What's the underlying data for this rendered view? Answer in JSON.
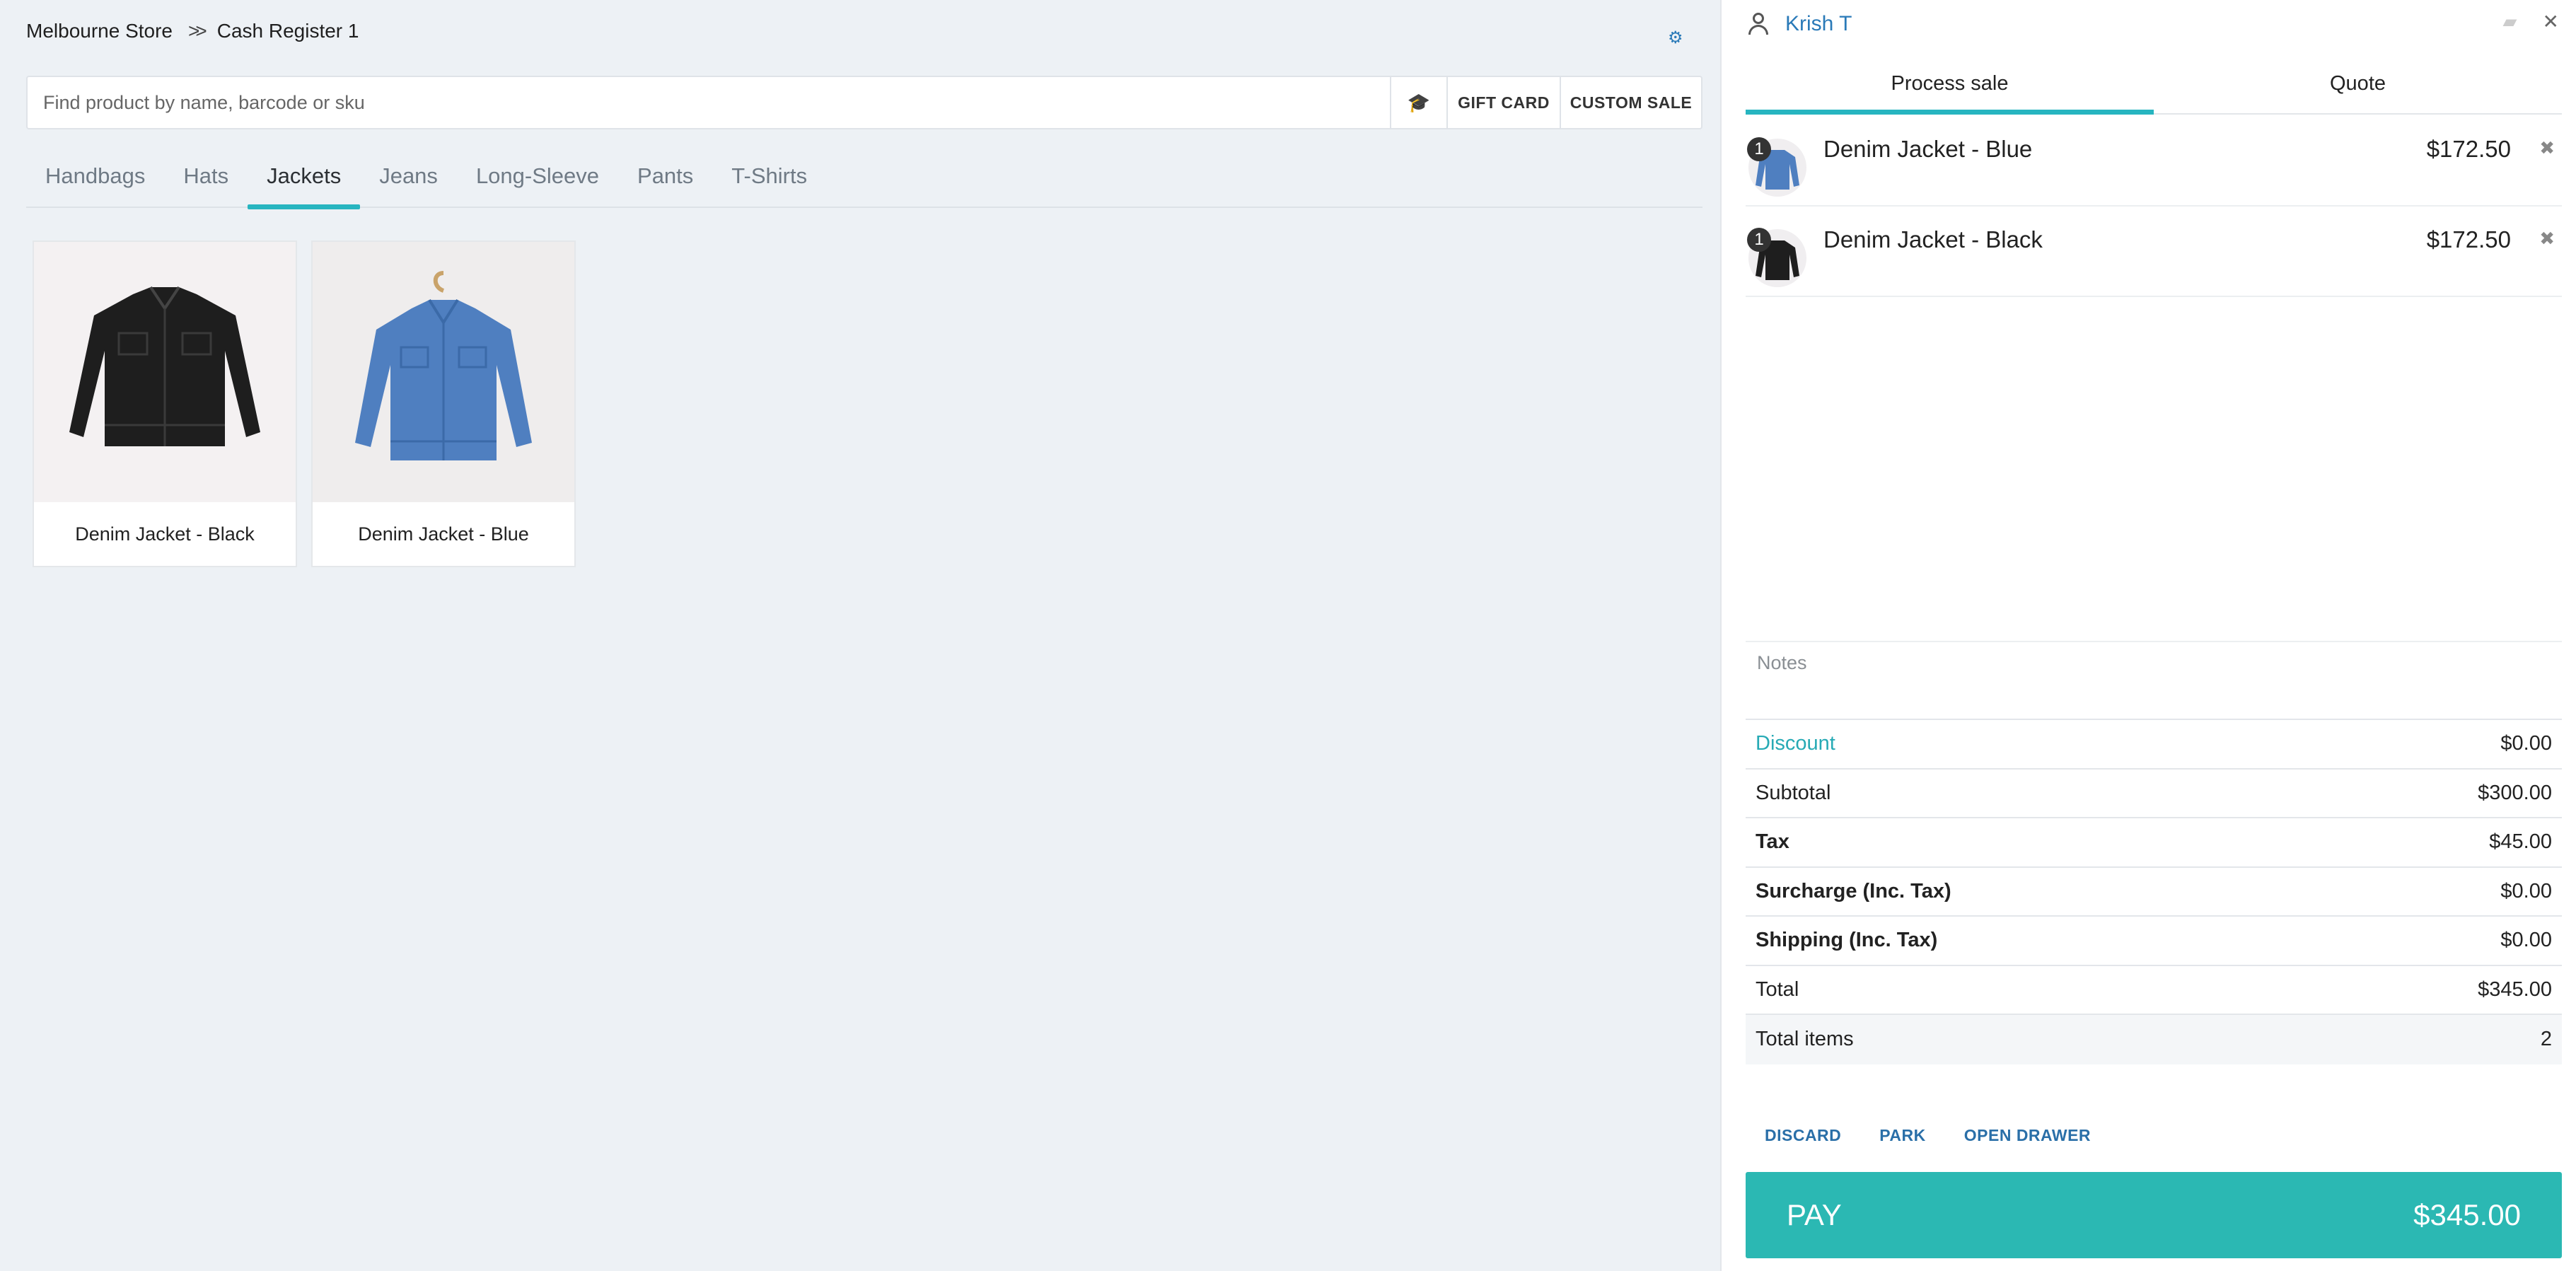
{
  "breadcrumb": {
    "store": "Melbourne Store",
    "register": "Cash Register 1"
  },
  "search": {
    "placeholder": "Find product by name, barcode or sku",
    "gift_card_label": "GIFT CARD",
    "custom_sale_label": "CUSTOM SALE"
  },
  "categories": [
    "Handbags",
    "Hats",
    "Jackets",
    "Jeans",
    "Long-Sleeve",
    "Pants",
    "T-Shirts"
  ],
  "active_category": "Jackets",
  "products": [
    {
      "name": "Denim Jacket - Black",
      "color": "#1e1e1e"
    },
    {
      "name": "Denim Jacket - Blue",
      "color": "#4f7fc0"
    }
  ],
  "customer": {
    "name": "Krish T"
  },
  "sale_tabs": {
    "process": "Process sale",
    "quote": "Quote"
  },
  "cart": [
    {
      "qty": "1",
      "name": "Denim Jacket - Blue",
      "price": "$172.50"
    },
    {
      "qty": "1",
      "name": "Denim Jacket - Black",
      "price": "$172.50"
    }
  ],
  "notes": {
    "placeholder": "Notes"
  },
  "totals": {
    "discount_label": "Discount",
    "discount": "$0.00",
    "subtotal_label": "Subtotal",
    "subtotal": "$300.00",
    "tax_label": "Tax",
    "tax": "$45.00",
    "surcharge_label": "Surcharge (Inc. Tax)",
    "surcharge": "$0.00",
    "shipping_label": "Shipping (Inc. Tax)",
    "shipping": "$0.00",
    "total_label": "Total",
    "total": "$345.00",
    "items_label": "Total items",
    "items": "2"
  },
  "actions": {
    "discard": "DISCARD",
    "park": "PARK",
    "open_drawer": "OPEN DRAWER"
  },
  "pay": {
    "label": "PAY",
    "amount": "$345.00"
  },
  "colors": {
    "accent": "#27b5c0",
    "link": "#2a7ab8",
    "pay": "#2bb8b3"
  }
}
